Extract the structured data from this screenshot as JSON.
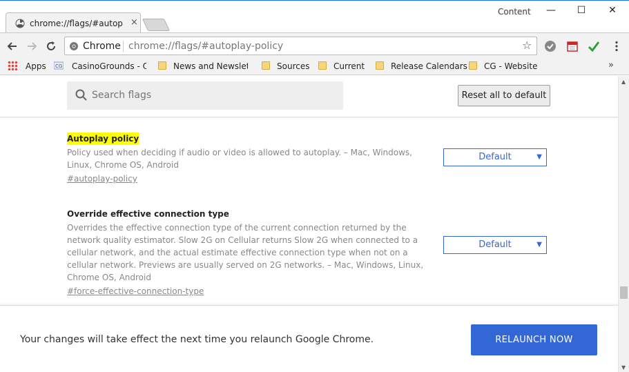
{
  "window": {
    "profile_name": "Content",
    "minimize": "—",
    "maximize": "☐",
    "close": "✕"
  },
  "tab": {
    "title": "chrome://flags/#autoplay-policy",
    "close": "×"
  },
  "toolbar": {
    "omnibox_label": "Chrome",
    "url": "chrome://flags/#autoplay-policy",
    "bookmark_star": "☆"
  },
  "bookmarks": {
    "items": [
      {
        "label": "Apps",
        "icon": "apps-grid-icon"
      },
      {
        "label": "CasinoGrounds - On",
        "icon": "casinogrounds-icon"
      },
      {
        "label": "News and Newslette",
        "icon": "folder-icon"
      },
      {
        "label": "Sources",
        "icon": "folder-icon"
      },
      {
        "label": "Current",
        "icon": "folder-icon"
      },
      {
        "label": "Release Calendars",
        "icon": "folder-icon"
      },
      {
        "label": "CG - Website",
        "icon": "folder-icon"
      }
    ],
    "more": "»"
  },
  "search": {
    "placeholder": "Search flags"
  },
  "reset_label": "Reset all to default",
  "flags": [
    {
      "name": "Autoplay policy",
      "description": "Policy used when deciding if audio or video is allowed to autoplay. – Mac, Windows, Linux, Chrome OS, Android",
      "link": "#autoplay-policy",
      "value": "Default"
    },
    {
      "name": "Override effective connection type",
      "description": "Overrides the effective connection type of the current connection returned by the network quality estimator. Slow 2G on Cellular returns Slow 2G when connected to a cellular network, and the actual estimate effective connection type when not on a cellular network. Previews are usually served on 2G networks. – Mac, Windows, Linux, Chrome OS, Android",
      "link": "#force-effective-connection-type",
      "value": "Default"
    }
  ],
  "relaunch": {
    "message": "Your changes will take effect the next time you relaunch Google Chrome.",
    "button": "RELAUNCH NOW"
  },
  "colors": {
    "accent": "#3367d6",
    "highlight": "#ffff00"
  }
}
